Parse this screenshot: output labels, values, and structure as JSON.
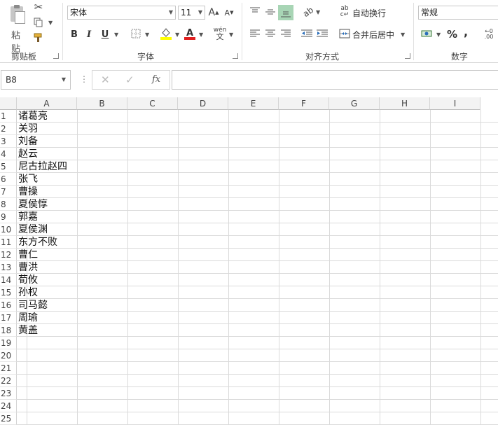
{
  "ribbon": {
    "clipboard": {
      "paste_label": "粘贴",
      "group_label": "剪贴板"
    },
    "font": {
      "font_name": "宋体",
      "font_size": "11",
      "bold": "B",
      "italic": "I",
      "underline": "U",
      "group_label": "字体"
    },
    "alignment": {
      "wrap_text": "自动换行",
      "merge_center": "合并后居中",
      "group_label": "对齐方式"
    },
    "number": {
      "format": "常规",
      "percent": "%",
      "comma": ",",
      "group_label": "数字"
    }
  },
  "formula_bar": {
    "name_box": "B8",
    "fx": "fx",
    "cancel": "✕",
    "enter": "✓",
    "value": ""
  },
  "sheet": {
    "columns": [
      "A",
      "B",
      "C",
      "D",
      "E",
      "F",
      "G",
      "H",
      "I"
    ],
    "rows": [
      "1",
      "2",
      "3",
      "4",
      "5",
      "6",
      "7",
      "8",
      "9",
      "10",
      "11",
      "12",
      "13",
      "14",
      "15",
      "16",
      "17",
      "18",
      "19",
      "20",
      "21",
      "22",
      "23",
      "24",
      "25"
    ],
    "column_a": [
      "诸葛亮",
      "关羽",
      "刘备",
      "赵云",
      "尼古拉赵四",
      "张飞",
      "曹操",
      "夏侯惇",
      "郭嘉",
      "夏侯渊",
      "东方不败",
      "曹仁",
      "曹洪",
      "荀攸",
      "孙权",
      "司马懿",
      "周瑜",
      "黄盖"
    ]
  }
}
